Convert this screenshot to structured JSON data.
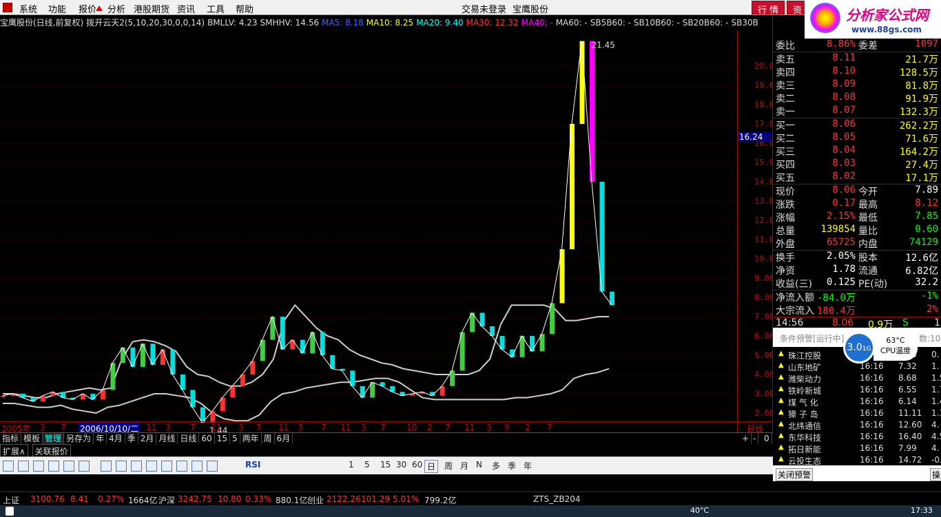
{
  "menubar": {
    "items": [
      "系统",
      "功能",
      "报价",
      "分析",
      "港股期货",
      "资讯",
      "工具",
      "帮助"
    ],
    "center_left": "交易未登录",
    "center_right": "宝鹰股份",
    "btn_quote": "行 情",
    "btn_trade": "资"
  },
  "logo": {
    "title": "分析家公式网",
    "url": "www.88gs.com"
  },
  "chart_header": [
    {
      "text": "宝鹰股份(日线,前复权)",
      "color": "#dddddd"
    },
    {
      "text": "拨开云天2(5,10,20,30,0,0,14)",
      "color": "#dddddd"
    },
    {
      "text": "BMLLV: 4.23",
      "color": "#dddddd"
    },
    {
      "text": "SMHHV: 14.56",
      "color": "#dddddd"
    },
    {
      "text": "MA5: 8.18",
      "color": "#4466ff"
    },
    {
      "text": "MA10: 8.25",
      "color": "#ffff00"
    },
    {
      "text": "MA20: 9.40",
      "color": "#00ffff"
    },
    {
      "text": "MA30: 12.32",
      "color": "#ff3333"
    },
    {
      "text": "MA40: -",
      "color": "#ff00ff"
    },
    {
      "text": "MA60: -",
      "color": "#dddddd"
    },
    {
      "text": "SB5B60: -",
      "color": "#dddddd"
    },
    {
      "text": "SB10B60: -",
      "color": "#dddddd"
    },
    {
      "text": "SB20B60: -",
      "color": "#dddddd"
    },
    {
      "text": "SB30B",
      "color": "#dddddd"
    }
  ],
  "chart_data": {
    "type": "line",
    "title": "宝鹰股份(日线,前复权)",
    "ylim": [
      1.5,
      21.5
    ],
    "yticks": [
      "20.00",
      "19.00",
      "18.00",
      "17.00",
      "16.00",
      "15.00",
      "14.00",
      "13.00",
      "12.00",
      "11.00",
      "10.00",
      "9.00",
      "8.00",
      "7.00",
      "6.00",
      "5.00",
      "4.00",
      "3.00",
      "2.00"
    ],
    "current_price_label": "16.24",
    "max_label": "21.45",
    "min_label": "1.44",
    "xlabels": [
      "2005年",
      "3",
      "7",
      "2006/10/10/二",
      "11",
      "3",
      "7",
      "11",
      "3",
      "7",
      "11",
      "3",
      "7",
      "11",
      "3",
      "7",
      "10",
      "2",
      "7",
      "11",
      "3",
      "9",
      "2",
      "7"
    ],
    "period_label": "日线",
    "price_series": [
      2.9,
      3.0,
      2.8,
      2.6,
      2.9,
      3.1,
      2.8,
      2.7,
      3.0,
      2.7,
      3.2,
      4.6,
      5.4,
      4.4,
      5.6,
      4.5,
      5.3,
      4.0,
      3.2,
      2.3,
      1.5,
      2.1,
      2.8,
      3.4,
      4.0,
      4.7,
      5.8,
      7.0,
      5.3,
      5.8,
      5.1,
      6.2,
      5.0,
      4.3,
      4.2,
      3.4,
      2.8,
      3.6,
      3.4,
      3.1,
      2.9,
      3.0,
      3.1,
      2.9,
      3.4,
      4.2,
      6.2,
      7.2,
      6.5,
      6.0,
      5.3,
      4.9,
      6.0,
      5.2,
      6.1,
      7.7,
      10.5,
      17.0,
      21.3,
      14.0,
      8.3,
      7.6
    ],
    "upper_band": [
      3.0,
      3.0,
      2.9,
      2.8,
      2.8,
      3.0,
      3.1,
      3.2,
      3.3,
      3.2,
      3.3,
      4.8,
      5.7,
      5.8,
      5.7,
      5.5,
      5.2,
      4.4,
      4.0,
      3.9,
      3.6,
      3.4,
      3.4,
      3.6,
      4.0,
      4.8,
      6.8,
      7.6,
      7.0,
      6.4,
      6.0,
      5.8,
      5.3,
      5.0,
      4.8,
      4.6,
      4.5,
      4.3,
      4.2,
      4.1,
      4.0,
      4.0,
      4.0,
      4.0,
      4.2,
      4.8,
      6.6,
      7.6,
      7.6,
      7.6,
      7.6,
      7.4,
      6.8,
      6.8,
      6.9,
      7.0,
      7.0
    ],
    "lower_band": [
      2.5,
      2.5,
      2.4,
      2.3,
      2.3,
      2.4,
      2.2,
      2.1,
      2.0,
      2.3,
      2.4,
      2.6,
      2.8,
      3.0,
      3.0,
      2.9,
      2.8,
      2.5,
      2.0,
      1.7,
      1.6,
      1.6,
      1.9,
      2.6,
      3.0,
      3.1,
      3.3,
      3.4,
      3.5,
      3.6,
      3.6,
      3.7,
      3.8,
      3.8,
      3.6,
      3.2,
      2.8,
      2.7,
      2.7,
      2.7,
      2.7,
      2.7,
      2.7,
      2.7,
      2.8,
      2.8,
      2.9,
      3.0,
      3.2,
      3.8,
      4.0,
      4.1,
      4.3
    ]
  },
  "tabs1": [
    "指标",
    "模板",
    "管理",
    "另存为",
    "年",
    "4月",
    "季",
    "2月",
    "月线",
    "日线",
    "60",
    "15",
    "5",
    "两年",
    "周",
    "6月"
  ],
  "tabs1_right": [
    "+",
    "-",
    "0"
  ],
  "tabs2": [
    "扩展∧",
    "关联报价"
  ],
  "toolbar": {
    "nums": [
      "1",
      "5",
      "15",
      "30",
      "60"
    ],
    "periods": [
      "日",
      "周",
      "月",
      "N",
      "多",
      "季",
      "年"
    ],
    "rsi": "RSI"
  },
  "right_panel": {
    "weibi": {
      "l": "委比",
      "v": "8.86%",
      "l2": "委差",
      "v2": "1097"
    },
    "sell": [
      {
        "l": "卖五",
        "p": "8.11",
        "q": "21.7万"
      },
      {
        "l": "卖四",
        "p": "8.10",
        "q": "128.5万"
      },
      {
        "l": "卖三",
        "p": "8.09",
        "q": "81.8万"
      },
      {
        "l": "卖二",
        "p": "8.08",
        "q": "91.9万"
      },
      {
        "l": "卖一",
        "p": "8.07",
        "q": "132.3万"
      }
    ],
    "buy": [
      {
        "l": "买一",
        "p": "8.06",
        "q": "262.2万"
      },
      {
        "l": "买二",
        "p": "8.05",
        "q": "71.6万"
      },
      {
        "l": "买三",
        "p": "8.04",
        "q": "164.2万"
      },
      {
        "l": "买四",
        "p": "8.03",
        "q": "27.4万"
      },
      {
        "l": "买五",
        "p": "8.02",
        "q": "17.1万"
      }
    ],
    "stats": [
      {
        "l": "现价",
        "v": "8.06",
        "c": "#ff3333",
        "l2": "今开",
        "v2": "7.89",
        "c2": "#ffffff"
      },
      {
        "l": "涨跌",
        "v": "0.17",
        "c": "#ff3333",
        "l2": "最高",
        "v2": "8.12",
        "c2": "#ff3333"
      },
      {
        "l": "涨幅",
        "v": "2.15%",
        "c": "#ff3333",
        "l2": "最低",
        "v2": "7.85",
        "c2": "#00ff00"
      },
      {
        "l": "总量",
        "v": "139854",
        "c": "#ffff00",
        "l2": "量比",
        "v2": "0.60",
        "c2": "#00ff00"
      },
      {
        "l": "外盘",
        "v": "65725",
        "c": "#ff3333",
        "l2": "内盘",
        "v2": "74129",
        "c2": "#00ff00"
      }
    ],
    "stats2": [
      {
        "l": "换手",
        "v": "2.05%",
        "c": "#ffffff",
        "l2": "股本",
        "v2": "12.6亿",
        "c2": "#ffffff"
      },
      {
        "l": "净资",
        "v": "1.78",
        "c": "#ffffff",
        "l2": "流通",
        "v2": "6.82亿",
        "c2": "#ffffff"
      },
      {
        "l": "收益(三)",
        "v": "0.125",
        "c": "#ffffff",
        "l2": "PE(动)",
        "v2": "32.2",
        "c2": "#ffffff"
      }
    ],
    "flow": [
      {
        "l": "净流入额",
        "v": "-84.0万",
        "c": "#00ff00",
        "v2": "-1%",
        "c2": "#00ff00"
      },
      {
        "l": "大宗流入",
        "v": "180.4万",
        "c": "#ff3333",
        "v2": "2%",
        "c2": "#ff3333"
      }
    ],
    "last_trade": {
      "time": "14:56",
      "price": "8.06",
      "vol": "0.9万",
      "flag": "S",
      "n": "1"
    }
  },
  "alert": {
    "header": "条件预警[运行中]",
    "header_right": "数:10",
    "cpu_mem": "3.0",
    "cpu_mem_unit": "1G",
    "cpu_temp": "63°C",
    "cpu_label": "CPU温度",
    "rows": [
      {
        "name": "珠江控股",
        "time": "16:16",
        "price": "7.20",
        "chg": "0."
      },
      {
        "name": "山东地矿",
        "time": "16:16",
        "price": "7.32",
        "chg": "1."
      },
      {
        "name": "潍柴动力",
        "time": "16:16",
        "price": "8.68",
        "chg": "1.5"
      },
      {
        "name": "铁岭新城",
        "time": "16:16",
        "price": "6.55",
        "chg": "1.7"
      },
      {
        "name": "煤 气 化",
        "time": "16:16",
        "price": "6.14",
        "chg": "1.4"
      },
      {
        "name": "獐 子 岛",
        "time": "16:16",
        "price": "11.11",
        "chg": "1.3"
      },
      {
        "name": "北纬通信",
        "time": "16:16",
        "price": "12.60",
        "chg": "4."
      },
      {
        "name": "东华科技",
        "time": "16:16",
        "price": "16.40",
        "chg": "4.5"
      },
      {
        "name": "拓日新能",
        "time": "16:16",
        "price": "7.99",
        "chg": "4."
      },
      {
        "name": "云投生态",
        "time": "16:16",
        "price": "14.72",
        "chg": "-0.2"
      }
    ],
    "close_btn": "关闭预警",
    "op_btn": "操"
  },
  "statusbar": [
    {
      "text": "上证",
      "color": "#dddddd"
    },
    {
      "text": "3100.76",
      "color": "#ff3333"
    },
    {
      "text": "8.41",
      "color": "#ff3333"
    },
    {
      "text": "0.27%",
      "color": "#ff3333"
    },
    {
      "text": "1664亿",
      "color": "#dddddd"
    },
    {
      "text": "沪深",
      "color": "#dddddd"
    },
    {
      "text": "3242.75",
      "color": "#ff3333"
    },
    {
      "text": "10.80",
      "color": "#ff3333"
    },
    {
      "text": "0.33%",
      "color": "#ff3333"
    },
    {
      "text": "880.1亿",
      "color": "#dddddd"
    },
    {
      "text": "创业",
      "color": "#dddddd"
    },
    {
      "text": "2122.26",
      "color": "#ff3333"
    },
    {
      "text": "101.29",
      "color": "#ff3333"
    },
    {
      "text": "5.01%",
      "color": "#ff3333"
    },
    {
      "text": "799.2亿",
      "color": "#dddddd"
    },
    {
      "text": "ZTS_ZB204",
      "color": "#dddddd"
    }
  ],
  "taskbar": {
    "temp": "40°C",
    "time": "17:33"
  }
}
